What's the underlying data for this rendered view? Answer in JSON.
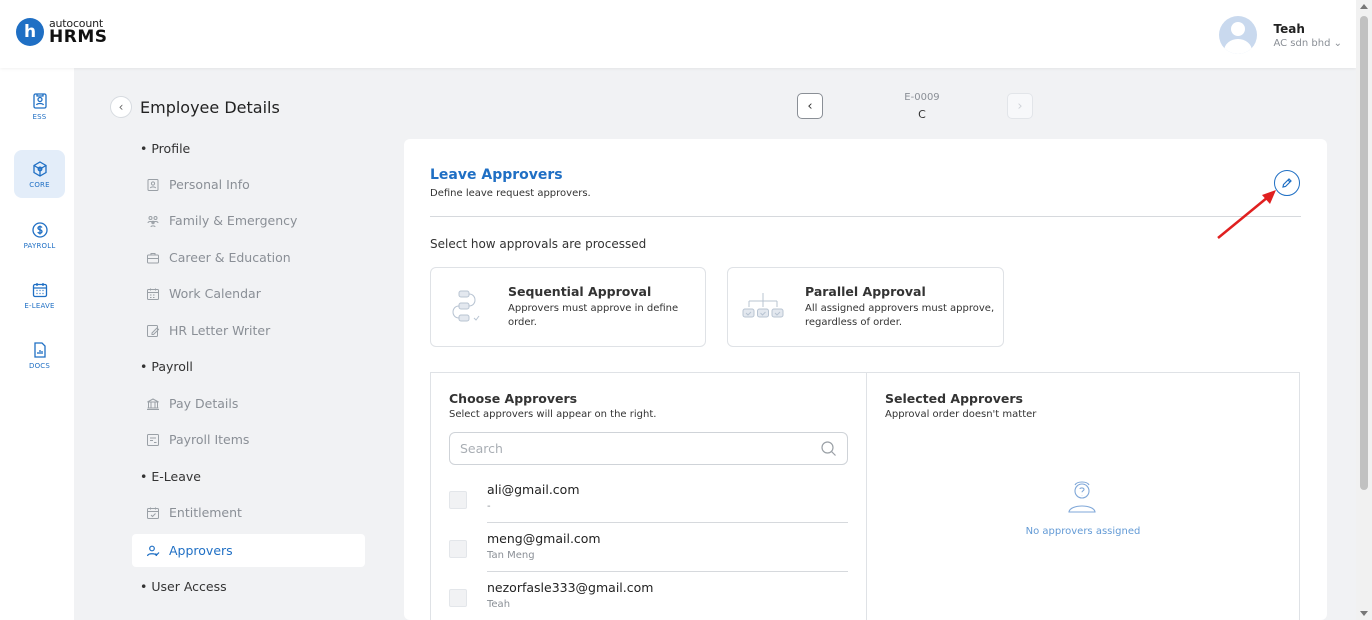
{
  "brand": {
    "mark": "h",
    "small": "autocount",
    "big": "HRMS",
    "accent": "#1f6fc4"
  },
  "user": {
    "name": "Teah",
    "company": "AC sdn bhd"
  },
  "rail": [
    {
      "label": "ESS",
      "icon": "id-card-icon"
    },
    {
      "label": "CORE",
      "icon": "cube-icon",
      "active": true
    },
    {
      "label": "PAYROLL",
      "icon": "dollar-icon"
    },
    {
      "label": "E-LEAVE",
      "icon": "calendar-icon"
    },
    {
      "label": "DOCS",
      "icon": "document-chart-icon"
    }
  ],
  "page": {
    "title": "Employee Details"
  },
  "employee": {
    "code": "E-0009",
    "name": "C"
  },
  "nav": {
    "profile": "Profile",
    "personal_info": "Personal Info",
    "family": "Family & Emergency",
    "career": "Career & Education",
    "work_calendar": "Work Calendar",
    "hr_letter": "HR Letter Writer",
    "payroll": "Payroll",
    "pay_details": "Pay Details",
    "payroll_items": "Payroll Items",
    "eleave": "E-Leave",
    "entitlement": "Entitlement",
    "approvers": "Approvers",
    "user_access": "User Access"
  },
  "card": {
    "title": "Leave Approvers",
    "subtitle": "Define leave request approvers.",
    "process_label": "Select how approvals are processed",
    "options": [
      {
        "title": "Sequential Approval",
        "desc": "Approvers must approve in define order."
      },
      {
        "title": "Parallel Approval",
        "desc": "All assigned approvers must approve, regardless of order."
      }
    ],
    "choose": {
      "title": "Choose Approvers",
      "subtitle": "Select approvers will appear on the right.",
      "search_placeholder": "Search",
      "rows": [
        {
          "email": "ali@gmail.com",
          "name": "-"
        },
        {
          "email": "meng@gmail.com",
          "name": "Tan Meng"
        },
        {
          "email": "nezorfasle333@gmail.com",
          "name": "Teah"
        }
      ]
    },
    "selected": {
      "title": "Selected Approvers",
      "subtitle": "Approval order doesn't matter",
      "empty": "No approvers assigned"
    }
  }
}
